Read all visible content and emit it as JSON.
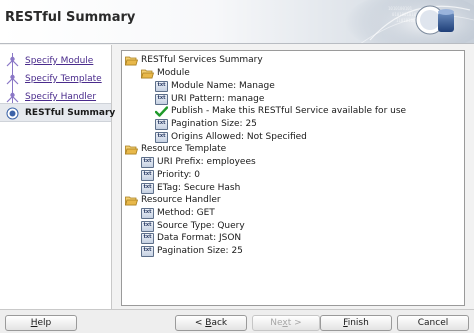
{
  "window": {
    "title": "RESTful Summary"
  },
  "steps": [
    {
      "label": "Specify Module",
      "state": "link"
    },
    {
      "label": "Specify Template",
      "state": "link"
    },
    {
      "label": "Specify Handler",
      "state": "link"
    },
    {
      "label": "RESTful Summary",
      "state": "current"
    }
  ],
  "tree": {
    "root": "RESTful Services Summary",
    "module": {
      "label": "Module",
      "items": [
        "Module Name: Manage",
        "URI Pattern: manage",
        "Publish - Make this RESTful Service available for use",
        "Pagination Size: 25",
        "Origins Allowed: Not Specified"
      ]
    },
    "template": {
      "label": "Resource Template",
      "items": [
        "URI Prefix: employees",
        "Priority: 0",
        "ETag: Secure Hash"
      ]
    },
    "handler": {
      "label": "Resource Handler",
      "items": [
        "Method: GET",
        "Source Type: Query",
        "Data Format: JSON",
        "Pagination Size: 25"
      ]
    }
  },
  "buttons": {
    "help": {
      "pre": "",
      "mnemonic": "H",
      "post": "elp"
    },
    "back": {
      "pre": "< ",
      "mnemonic": "B",
      "post": "ack"
    },
    "next": {
      "pre": "Ne",
      "mnemonic": "x",
      "post": "t >"
    },
    "finish": {
      "pre": "",
      "mnemonic": "F",
      "post": "inish"
    },
    "cancel": {
      "pre": "Cancel",
      "mnemonic": "",
      "post": ""
    }
  },
  "colors": {
    "link": "#4a2b8c",
    "check": "#1f9a2a",
    "folder": "#e8b84a"
  }
}
